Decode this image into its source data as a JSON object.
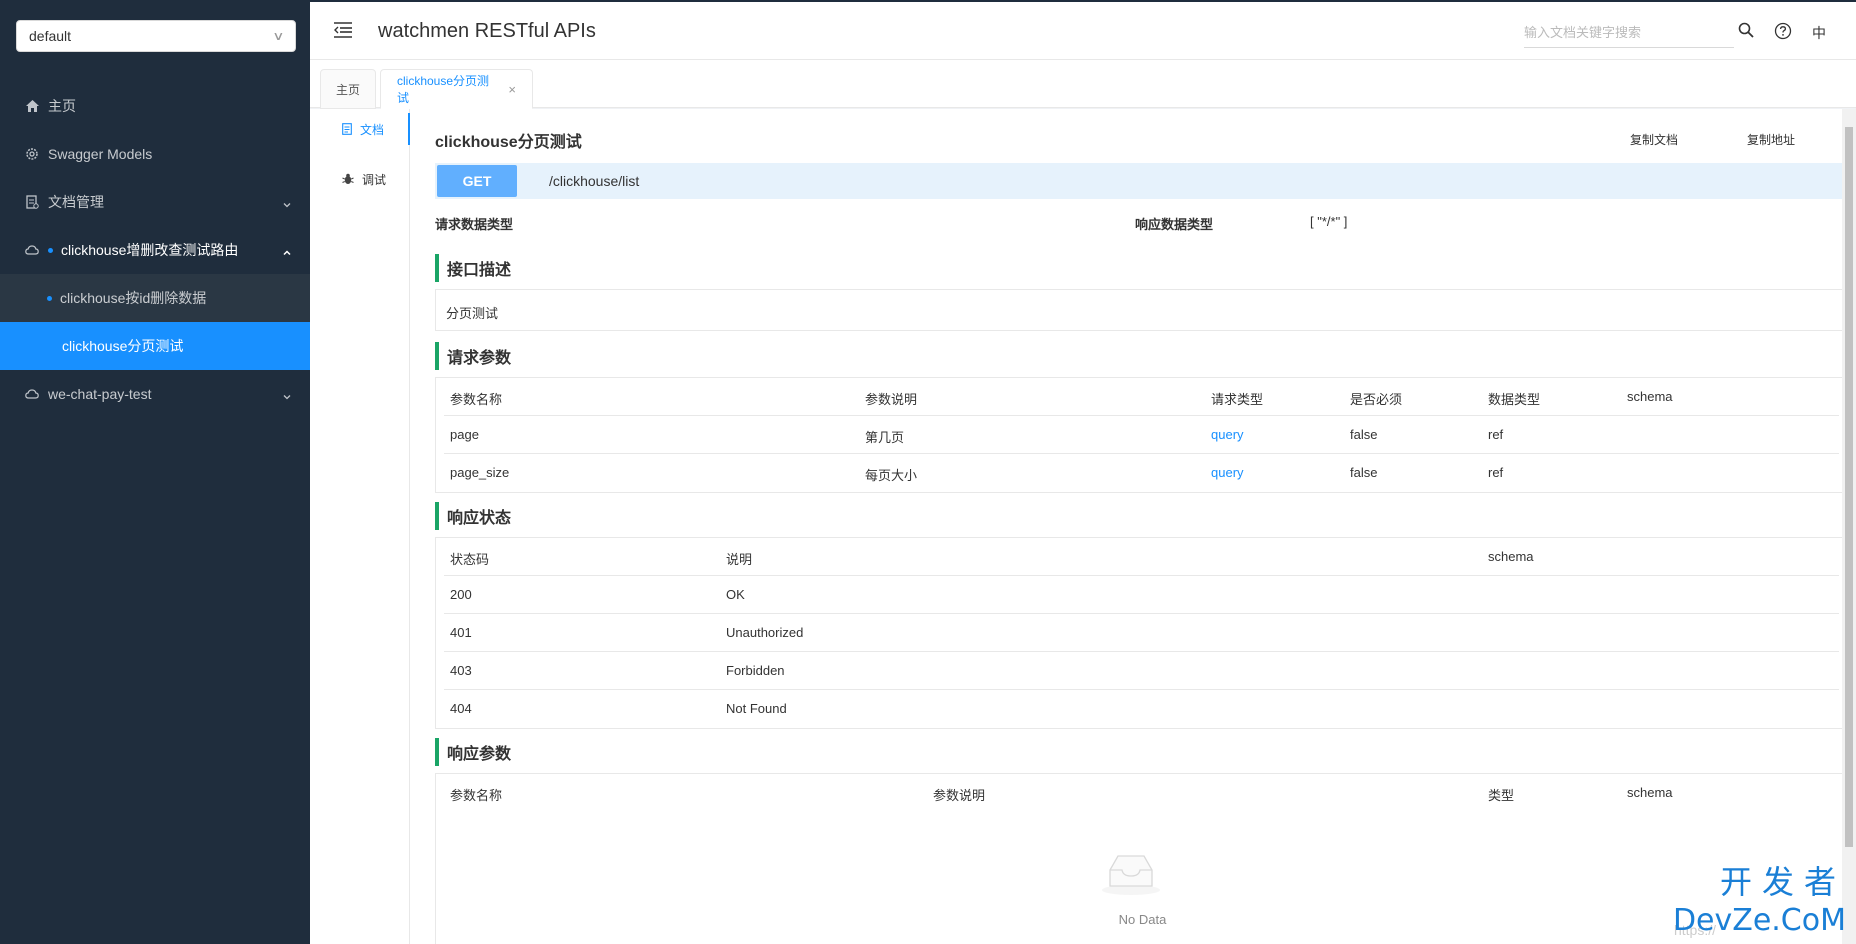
{
  "sidebar": {
    "group_select": "default",
    "items": [
      {
        "label": "主页",
        "icon": "home-icon"
      },
      {
        "label": "Swagger Models",
        "icon": "gear-icon"
      },
      {
        "label": "文档管理",
        "icon": "doc-manage-icon"
      },
      {
        "label": "clickhouse增删改查测试路由",
        "icon": "cloud-icon"
      },
      {
        "label": "we-chat-pay-test",
        "icon": "cloud-icon"
      }
    ],
    "submenu": [
      {
        "label": "clickhouse按id删除数据"
      },
      {
        "label": "clickhouse分页测试"
      }
    ]
  },
  "header": {
    "title": "watchmen RESTful APIs",
    "search_placeholder": "输入文档关键字搜索",
    "lang": "中"
  },
  "tabs": [
    {
      "label": "主页"
    },
    {
      "label": "clickhouse分页测试",
      "close": "×"
    }
  ],
  "doc_nav": [
    {
      "label": "文档",
      "icon": "doc-icon"
    },
    {
      "label": "调试",
      "icon": "bug-icon"
    }
  ],
  "doc": {
    "title": "clickhouse分页测试",
    "copy_doc": "复制文档",
    "copy_url": "复制地址",
    "method": "GET",
    "path": "/clickhouse/list",
    "req_type_label": "请求数据类型",
    "resp_type_label": "响应数据类型",
    "resp_type_value": "[ \"*/*\" ]",
    "sections": {
      "desc": "接口描述",
      "req_params": "请求参数",
      "resp_status": "响应状态",
      "resp_params": "响应参数"
    },
    "description": "分页测试",
    "req_table": {
      "headers": [
        "参数名称",
        "参数说明",
        "请求类型",
        "是否必须",
        "数据类型",
        "schema"
      ],
      "rows": [
        [
          "page",
          "第几页",
          "query",
          "false",
          "ref",
          ""
        ],
        [
          "page_size",
          "每页大小",
          "query",
          "false",
          "ref",
          ""
        ]
      ]
    },
    "status_table": {
      "headers": [
        "状态码",
        "说明",
        "schema"
      ],
      "rows": [
        [
          "200",
          "OK",
          ""
        ],
        [
          "401",
          "Unauthorized",
          ""
        ],
        [
          "403",
          "Forbidden",
          ""
        ],
        [
          "404",
          "Not Found",
          ""
        ]
      ]
    },
    "resp_table": {
      "headers": [
        "参数名称",
        "参数说明",
        "类型",
        "schema"
      ]
    },
    "no_data": "No Data"
  },
  "watermark": {
    "line1": "开发者",
    "line2": "DevZe.CoM",
    "faint": "https://"
  }
}
